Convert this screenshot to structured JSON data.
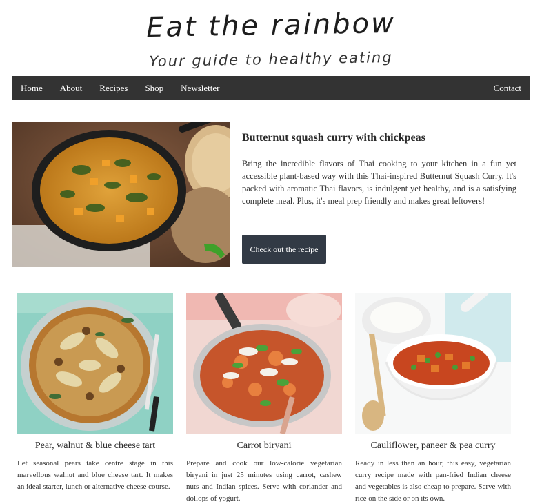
{
  "header": {
    "title": "Eat the rainbow",
    "subtitle": "Your guide to healthy eating"
  },
  "nav": {
    "items": [
      "Home",
      "About",
      "Recipes",
      "Shop",
      "Newsletter"
    ],
    "contact": "Contact"
  },
  "featured": {
    "title": "Butternut squash curry with chickpeas",
    "description": "Bring the incredible flavors of Thai cooking to your kitchen in a fun yet accessible plant-based way with this Thai-inspired Butternut Squash Curry. It's packed with aromatic Thai flavors, is indulgent yet healthy, and is a satisfying complete meal. Plus, it's meal prep friendly and makes great leftovers!",
    "button_label": "Check out the recipe",
    "image_alt": "skillet of butternut squash curry"
  },
  "cards": [
    {
      "title": "Pear, walnut & blue cheese tart",
      "description": "Let seasonal pears take centre stage in this marvellous walnut and blue cheese tart. It makes an ideal starter, lunch or alternative cheese course."
    },
    {
      "title": "Carrot biryani",
      "description": "Prepare and cook our low-calorie vegetarian biryani in just 25 minutes using carrot, cashew nuts and Indian spices. Serve with coriander and dollops of yogurt."
    },
    {
      "title": "Cauliflower, paneer & pea curry",
      "description": "Ready in less than an hour, this easy, vegetarian curry recipe made with pan-fried Indian cheese and vegetables is also cheap to prepare. Serve with rice on the side or on its own."
    }
  ],
  "colors": {
    "nav_bg": "#333333",
    "button_bg": "#323a45",
    "text": "#333333"
  }
}
